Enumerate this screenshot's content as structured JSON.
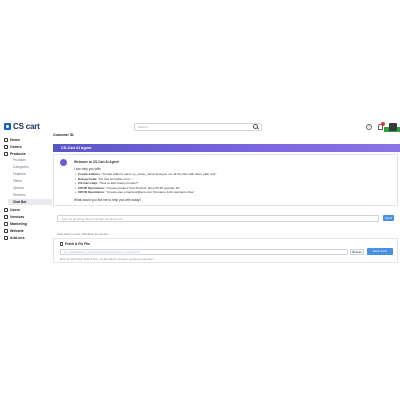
{
  "app": {
    "logo_text": "CS cart",
    "brand_color": "#1565c0"
  },
  "search": {
    "placeholder": "Search"
  },
  "sidebar": {
    "items": [
      {
        "label": "Home",
        "icon": "home-icon"
      },
      {
        "label": "Orders",
        "icon": "orders-icon"
      },
      {
        "label": "Products",
        "icon": "products-icon"
      }
    ],
    "sub_items": [
      "Products",
      "Categories",
      "Features",
      "Filters",
      "Options",
      "Reviews"
    ],
    "active_sub": "Chat Bot",
    "lower_items": [
      {
        "label": "Users",
        "icon": "users-icon"
      },
      {
        "label": "Vendors",
        "icon": "vendors-icon"
      },
      {
        "label": "Marketing",
        "icon": "marketing-icon"
      },
      {
        "label": "Website",
        "icon": "website-icon"
      },
      {
        "label": "Add-ons",
        "icon": "addons-icon"
      }
    ]
  },
  "main": {
    "customer_label": "Customer ID:",
    "agent_title": "CS-Cart AI Agent",
    "agent_header_color": "#6a5fd8",
    "chat": {
      "welcome": "Welcome to CS-Cart AI Agent!",
      "intro": "I can help you with:",
      "bullets": [
        {
          "title": "Create Addons:",
          "text": "\"Create addons name sy_name_name and give me all the files with there path only\""
        },
        {
          "title": "Debug Code:",
          "text": "\"Fix this controller error...\""
        },
        {
          "title": "CS-Cart Help:",
          "text": "\"How to add custom hooks?\""
        },
        {
          "title": "CRUD Operations:",
          "text": "\"Create product 'Test Product' price 99.99 quantity 10\""
        },
        {
          "title": "CRUD Operations:",
          "text": "\"Create user email test@test.com firstname John lastname Doe\""
        }
      ],
      "outro": "What would you like me to help you with today?"
    },
    "input": {
      "placeholder": "Ask me anything about CS-Cart development...",
      "send_label": "Send"
    },
    "input_hint": "Press Enter to send, Shift+Enter for new line",
    "fetch": {
      "title": "Fetch & Fix File",
      "input_placeholder": "e.g. app/addons/my_addon/controllers/backend/my_controller.php",
      "browse_label": "Browse",
      "fix_label": "Fetch & Fix",
      "hint": "Enter the path (from \"Fetch & Fix\") - AI will analyze, fix issues, and let you save them"
    }
  }
}
